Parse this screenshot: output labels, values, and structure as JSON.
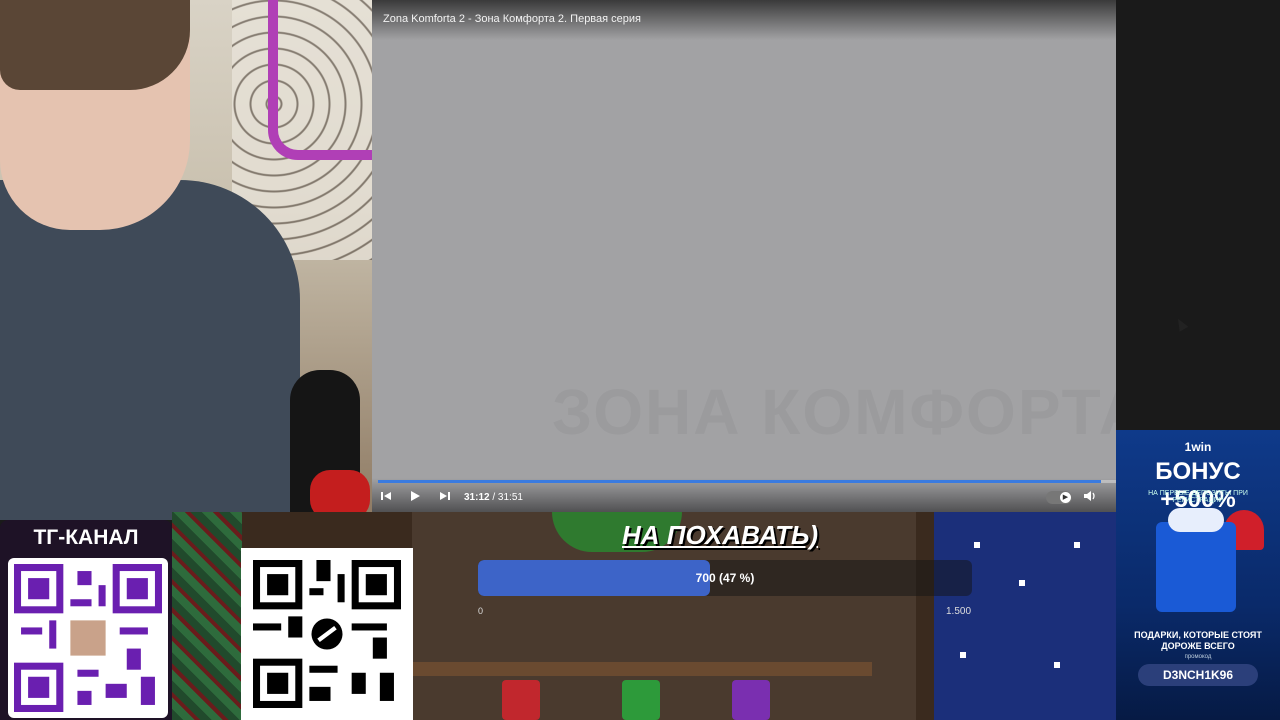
{
  "player": {
    "title": "Zona Komforta 2 - Зона Комфорта 2. Первая серия",
    "watermark": "ЗОНА КОМФОРТА",
    "time_current": "31:12",
    "time_separator": " / ",
    "time_total": "31:51",
    "progress": 0.98,
    "controls": {
      "prev_icon": "skip-back-icon",
      "play_icon": "play-icon",
      "next_icon": "skip-forward-icon",
      "autoplay_icon": "autoplay-toggle-icon",
      "volume_icon": "volume-icon"
    }
  },
  "tg_panel": {
    "label": "ТГ-КАНАЛ"
  },
  "donation_goal": {
    "title": "НА ПОХАВАТЬ)",
    "progress_text": "700 (47 %)",
    "progress_fraction": 0.47,
    "min_label": "0",
    "max_label": "1.500"
  },
  "ad": {
    "brand": "1win",
    "headline": "БОНУС +500%",
    "sub": "НА ПЕРВЫЕ ДЕПОЗИТЫ ПРИ РЕГИСТРАЦИИ",
    "tagline": "ПОДАРКИ, КОТОРЫЕ СТОЯТ ДОРОЖЕ ВСЕГО",
    "small": "промокод",
    "code": "D3NCH1K96"
  },
  "colors": {
    "accent": "#3a7be0",
    "goal_fill": "#3d64c8",
    "ad_bg": "#0f3a8a"
  }
}
